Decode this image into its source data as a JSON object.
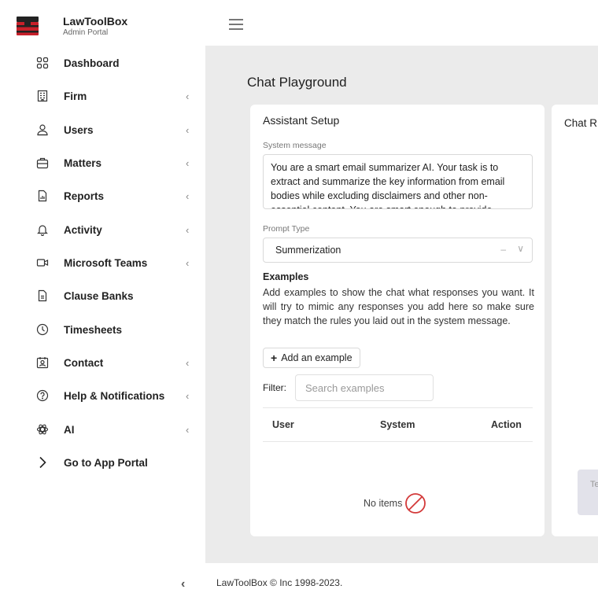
{
  "brand": {
    "name": "LawToolBox",
    "subtitle": "Admin Portal"
  },
  "sidebar": {
    "items": [
      {
        "label": "Dashboard",
        "icon": "dashboard-icon",
        "chevron": ""
      },
      {
        "label": "Firm",
        "icon": "building-icon",
        "chevron": "‹"
      },
      {
        "label": "Users",
        "icon": "users-icon",
        "chevron": "‹"
      },
      {
        "label": "Matters",
        "icon": "briefcase-icon",
        "chevron": "‹"
      },
      {
        "label": "Reports",
        "icon": "report-icon",
        "chevron": "‹"
      },
      {
        "label": "Activity",
        "icon": "bell-icon",
        "chevron": "‹"
      },
      {
        "label": "Microsoft Teams",
        "icon": "video-icon",
        "chevron": "‹"
      },
      {
        "label": "Clause Banks",
        "icon": "document-icon",
        "chevron": ""
      },
      {
        "label": "Timesheets",
        "icon": "clock-icon",
        "chevron": ""
      },
      {
        "label": "Contact",
        "icon": "contact-card-icon",
        "chevron": "‹"
      },
      {
        "label": "Help & Notifications",
        "icon": "help-icon",
        "chevron": "‹"
      },
      {
        "label": "AI",
        "icon": "ai-icon",
        "chevron": "‹"
      },
      {
        "label": "Go to App Portal",
        "icon": "chevron-right-icon",
        "chevron": ""
      }
    ],
    "collapse": "‹"
  },
  "main": {
    "title": "Chat Playground",
    "setup": {
      "title": "Assistant Setup",
      "system_label": "System message",
      "system_message": "You are a smart email summarizer AI. Your task is to extract and summarize the key information from email bodies while excluding disclaimers and other non-essential content. You are smart enough to provide precise and",
      "prompt_type_label": "Prompt Type",
      "prompt_type_value": "Summerization",
      "examples_title": "Examples",
      "examples_desc": "Add examples to show the chat what responses you want. It will try to mimic any responses you add here so make sure they match the rules you laid out in the system message.",
      "add_example_label": "Add an example",
      "filter_label": "Filter:",
      "filter_placeholder": "Search examples",
      "columns": [
        "User",
        "System",
        "Action"
      ],
      "empty_text": "No items"
    },
    "result": {
      "title": "Chat R",
      "button_label": "Te"
    }
  },
  "footer": {
    "text": "LawToolBox © Inc 1998-2023."
  }
}
